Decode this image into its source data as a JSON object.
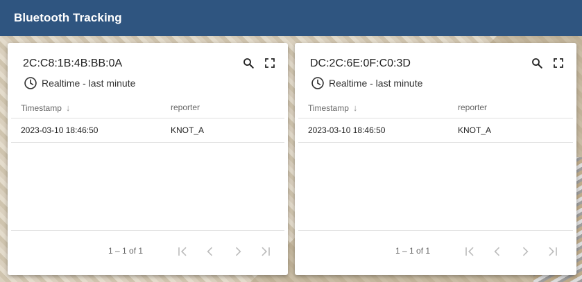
{
  "header": {
    "title": "Bluetooth Tracking"
  },
  "cards": [
    {
      "mac": "2C:C8:1B:4B:BB:0A",
      "range_label": "Realtime - last minute",
      "columns": {
        "timestamp": "Timestamp",
        "reporter": "reporter"
      },
      "rows": [
        {
          "timestamp": "2023-03-10 18:46:50",
          "reporter": "KNOT_A"
        }
      ],
      "paginator": {
        "range": "1 – 1 of 1"
      }
    },
    {
      "mac": "DC:2C:6E:0F:C0:3D",
      "range_label": "Realtime - last minute",
      "columns": {
        "timestamp": "Timestamp",
        "reporter": "reporter"
      },
      "rows": [
        {
          "timestamp": "2023-03-10 18:46:50",
          "reporter": "KNOT_A"
        }
      ],
      "paginator": {
        "range": "1 – 1 of 1"
      }
    }
  ],
  "icons": {
    "search": "search-icon",
    "fullscreen": "fullscreen-icon",
    "clock": "clock-icon",
    "sort": "arrow-down-icon",
    "first": "first-page-icon",
    "prev": "chevron-left-icon",
    "next": "chevron-right-icon",
    "last": "last-page-icon"
  },
  "colors": {
    "header": "#2f5580",
    "pager_disabled": "#bdbdbd"
  }
}
